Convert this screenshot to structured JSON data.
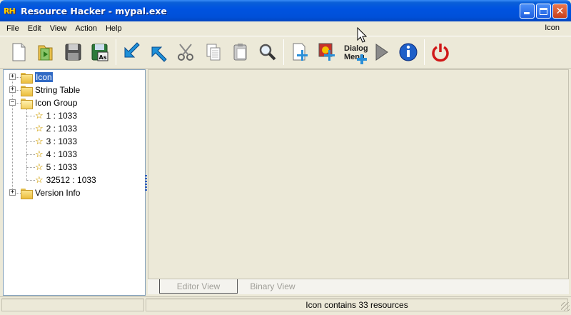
{
  "window": {
    "logo": "RH",
    "title": "Resource Hacker - mypal.exe"
  },
  "menu": {
    "items": [
      "File",
      "Edit",
      "View",
      "Action",
      "Help"
    ],
    "right_label": "Icon"
  },
  "toolbar": {
    "dialog_label_line1": "Dialog",
    "dialog_label_line2": "Menu"
  },
  "tree": {
    "nodes": [
      {
        "label": "Icon",
        "selected": true
      },
      {
        "label": "String Table"
      },
      {
        "label": "Icon Group",
        "expanded": true
      },
      {
        "label": "1 : 1033"
      },
      {
        "label": "2 : 1033"
      },
      {
        "label": "3 : 1033"
      },
      {
        "label": "4 : 1033"
      },
      {
        "label": "5 : 1033"
      },
      {
        "label": "32512 : 1033"
      },
      {
        "label": "Version Info"
      }
    ]
  },
  "tabs": {
    "editor_view": "Editor View",
    "binary_view": "Binary View"
  },
  "status": {
    "message": "Icon contains 33 resources"
  },
  "colors": {
    "title_bar": "#0053e0",
    "selection": "#316ac5",
    "window_bg": "#ece9d8"
  }
}
